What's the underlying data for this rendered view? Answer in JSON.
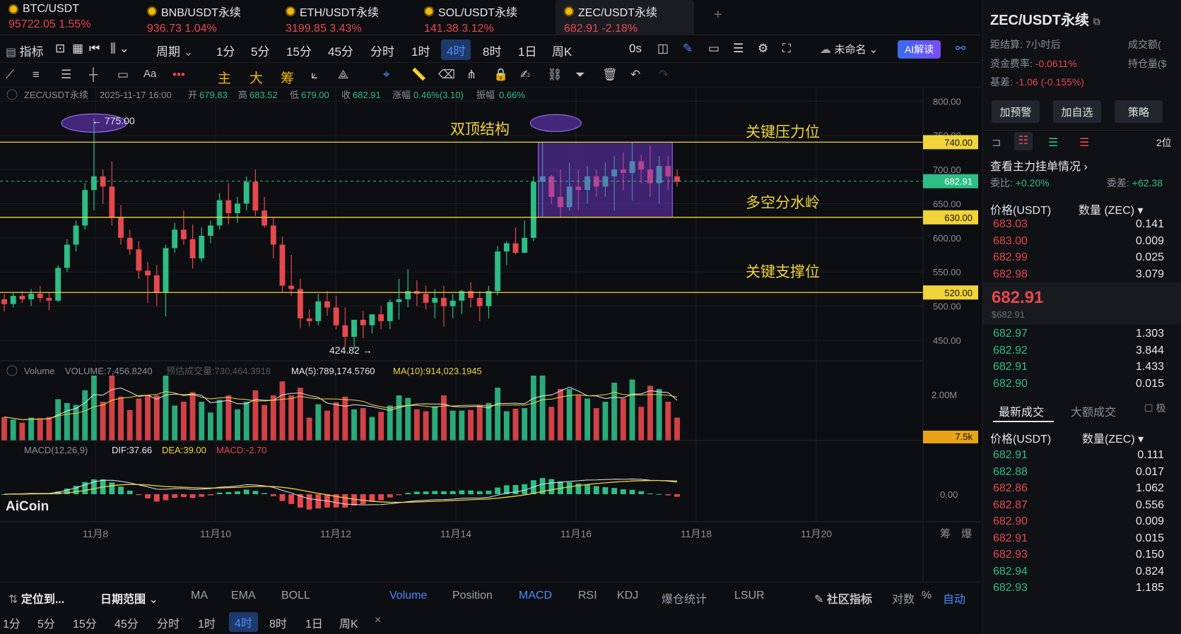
{
  "tabs": [
    {
      "symbol": "BTC/USDT",
      "price": "95722.05",
      "change": "1.55%"
    },
    {
      "symbol": "BNB/USDT永续",
      "price": "936.73",
      "change": "1.04%"
    },
    {
      "symbol": "ETH/USDT永续",
      "price": "3199.85",
      "change": "3.43%"
    },
    {
      "symbol": "SOL/USDT永续",
      "price": "141.38",
      "change": "3.12%"
    },
    {
      "symbol": "ZEC/USDT永续",
      "price": "682.91",
      "change": "-2.18%"
    }
  ],
  "toolbar": {
    "indicators": "指标",
    "period": "周期",
    "intervals": [
      "1分",
      "5分",
      "15分",
      "45分",
      "分时",
      "1时",
      "4时",
      "8时",
      "1日",
      "周K"
    ],
    "active_interval": "4时",
    "timer": "0s",
    "unnamed": "未命名",
    "ai": "AI解读"
  },
  "drawtools": {
    "main": "主",
    "big": "大",
    "chip": "筹"
  },
  "info": {
    "symbol": "ZEC/USDT永续",
    "datetime": "2025-11-17 16:00",
    "open_l": "开",
    "open": "679.83",
    "high_l": "高",
    "high": "683.52",
    "low_l": "低",
    "low": "679.00",
    "close_l": "收",
    "close": "682.91",
    "chg_l": "涨幅",
    "chg": "0.46%(3.10)",
    "amp_l": "振幅",
    "amp": "0.66%"
  },
  "volume_info": {
    "label": "Volume",
    "vol": "VOLUME:7,456.8240",
    "est": "预估成交量:730,464.3918",
    "ma5": "MA(5):789,174.5760",
    "ma10": "MA(10):914,023.1945"
  },
  "macd_info": {
    "label": "MACD(12,26,9)",
    "dif": "DIF:37.66",
    "dea": "DEA:39.00",
    "macd": "MACD:-2.70"
  },
  "annotations": {
    "double_top": "双顶结构",
    "resistance": "关键压力位",
    "watershed": "多空分水岭",
    "support": "关键支撑位",
    "high_mark": "← 775.00",
    "low_mark": "424.82 →"
  },
  "levels": {
    "r": "740.00",
    "cur": "682.91",
    "w": "630.00",
    "s": "520.00",
    "vol_tag": "7.5k"
  },
  "axis": {
    "price_ticks": [
      "800.00",
      "750.00",
      "700.00",
      "650.00",
      "600.00",
      "550.00",
      "500.00",
      "450.00"
    ],
    "vol_tick": "2.00M",
    "macd_tick": "0.00",
    "dates": [
      "11月8",
      "11月10",
      "11月12",
      "11月14",
      "11月16",
      "11月18",
      "11月20"
    ],
    "chip": "筹",
    "burst": "爆"
  },
  "logo": "AiCoin",
  "bottom": {
    "locate": "定位到...",
    "range": "日期范围",
    "inds": [
      "MA",
      "EMA",
      "BOLL",
      "Volume",
      "Position",
      "MACD",
      "RSI",
      "KDJ",
      "爆仓统计",
      "LSUR"
    ],
    "community": "社区指标",
    "log": "对数",
    "pct": "%",
    "auto": "自动"
  },
  "bottom_intervals": [
    "1分",
    "5分",
    "15分",
    "45分",
    "分时",
    "1时",
    "4时",
    "8时",
    "1日",
    "周K"
  ],
  "right": {
    "title": "ZEC/USDT永续",
    "settle_l": "距结算:",
    "settle": "7小时后",
    "turnover_l": "成交额(",
    "fund_l": "资金费率:",
    "fund": "-0.0611%",
    "oi_l": "持仓量($",
    "basis_l": "基差:",
    "basis": "-1.06 (-0.155%)",
    "btn1": "加预警",
    "btn2": "加自选",
    "btn3": "策略",
    "depth_lv": "2位",
    "main_orders": "查看主力挂单情况 ›",
    "ratio_l": "委比:",
    "ratio": "+0.20%",
    "diff_l": "委差:",
    "diff": "+62.38",
    "col_price": "价格(USDT)",
    "col_qty": "数量 (ZEC) ▾",
    "asks": [
      [
        "683.03",
        "0.141"
      ],
      [
        "683.00",
        "0.009"
      ],
      [
        "682.99",
        "0.025"
      ],
      [
        "682.98",
        "3.079"
      ]
    ],
    "last": "682.91",
    "last_usd": "$682.91",
    "bids": [
      [
        "682.97",
        "1.303"
      ],
      [
        "682.92",
        "3.844"
      ],
      [
        "682.91",
        "1.433"
      ],
      [
        "682.90",
        "0.015"
      ]
    ],
    "trades_tab1": "最新成交",
    "trades_tab2": "大额成交",
    "trades_tab3": "极",
    "col_price2": "价格(USDT)",
    "col_qty2": "数量(ZEC) ▾",
    "trades": [
      [
        "682.91",
        "0.111",
        "g"
      ],
      [
        "682.88",
        "0.017",
        "g"
      ],
      [
        "682.86",
        "1.062",
        "r"
      ],
      [
        "682.87",
        "0.556",
        "r"
      ],
      [
        "682.90",
        "0.009",
        "r"
      ],
      [
        "682.91",
        "0.015",
        "r"
      ],
      [
        "682.93",
        "0.150",
        "r"
      ],
      [
        "682.94",
        "0.824",
        "g"
      ],
      [
        "682.93",
        "1.185",
        "g"
      ]
    ]
  },
  "chart_data": {
    "type": "candlestick",
    "ohlc": [
      [
        510,
        518,
        492,
        503
      ],
      [
        503,
        520,
        498,
        515
      ],
      [
        515,
        522,
        505,
        510
      ],
      [
        510,
        525,
        500,
        518
      ],
      [
        518,
        530,
        506,
        512
      ],
      [
        512,
        520,
        494,
        508
      ],
      [
        508,
        560,
        506,
        556
      ],
      [
        556,
        598,
        550,
        590
      ],
      [
        590,
        625,
        580,
        618
      ],
      [
        618,
        680,
        612,
        670
      ],
      [
        670,
        775,
        640,
        690
      ],
      [
        690,
        700,
        650,
        675
      ],
      [
        675,
        712,
        618,
        630
      ],
      [
        630,
        648,
        590,
        600
      ],
      [
        600,
        612,
        575,
        583
      ],
      [
        583,
        595,
        540,
        552
      ],
      [
        552,
        565,
        505,
        545
      ],
      [
        545,
        560,
        500,
        520
      ],
      [
        520,
        590,
        485,
        585
      ],
      [
        585,
        622,
        578,
        612
      ],
      [
        612,
        640,
        590,
        598
      ],
      [
        598,
        620,
        555,
        570
      ],
      [
        570,
        615,
        565,
        603
      ],
      [
        603,
        625,
        592,
        618
      ],
      [
        618,
        665,
        612,
        655
      ],
      [
        655,
        680,
        620,
        636
      ],
      [
        636,
        660,
        622,
        650
      ],
      [
        650,
        690,
        640,
        682
      ],
      [
        682,
        700,
        632,
        640
      ],
      [
        640,
        660,
        615,
        618
      ],
      [
        618,
        630,
        570,
        590
      ],
      [
        590,
        602,
        520,
        530
      ],
      [
        530,
        575,
        515,
        525
      ],
      [
        525,
        540,
        468,
        482
      ],
      [
        482,
        495,
        470,
        478
      ],
      [
        478,
        518,
        472,
        507
      ],
      [
        507,
        522,
        486,
        498
      ],
      [
        498,
        515,
        466,
        472
      ],
      [
        472,
        498,
        440,
        455
      ],
      [
        455,
        476,
        438,
        480
      ],
      [
        480,
        493,
        453,
        472
      ],
      [
        472,
        486,
        460,
        488
      ],
      [
        488,
        500,
        466,
        478
      ],
      [
        478,
        510,
        466,
        506
      ],
      [
        506,
        540,
        480,
        510
      ],
      [
        510,
        554,
        498,
        522
      ],
      [
        522,
        538,
        500,
        518
      ],
      [
        518,
        530,
        495,
        505
      ],
      [
        505,
        525,
        482,
        512
      ],
      [
        512,
        530,
        470,
        500
      ],
      [
        500,
        518,
        482,
        508
      ],
      [
        508,
        524,
        488,
        522
      ],
      [
        522,
        535,
        498,
        512
      ],
      [
        512,
        522,
        478,
        500
      ],
      [
        500,
        530,
        482,
        522
      ],
      [
        522,
        588,
        516,
        580
      ],
      [
        580,
        595,
        560,
        592
      ],
      [
        592,
        615,
        576,
        578
      ],
      [
        578,
        625,
        585,
        600
      ],
      [
        600,
        690,
        595,
        682
      ],
      [
        682,
        740,
        630,
        690
      ],
      [
        690,
        692,
        650,
        660
      ],
      [
        660,
        700,
        630,
        645
      ],
      [
        645,
        710,
        640,
        675
      ],
      [
        675,
        700,
        640,
        670
      ],
      [
        670,
        705,
        650,
        690
      ],
      [
        690,
        700,
        660,
        675
      ],
      [
        675,
        710,
        660,
        690
      ],
      [
        690,
        720,
        640,
        700
      ],
      [
        700,
        725,
        670,
        695
      ],
      [
        695,
        740,
        655,
        712
      ],
      [
        712,
        722,
        680,
        700
      ],
      [
        700,
        735,
        660,
        680
      ],
      [
        680,
        720,
        650,
        705
      ],
      [
        705,
        720,
        670,
        690
      ],
      [
        690,
        700,
        675,
        682
      ]
    ],
    "price_axis": {
      "min": 420,
      "max": 820
    },
    "levels": [
      740,
      630,
      520
    ],
    "current": 682.91,
    "high": 775.0,
    "low": 424.82
  }
}
